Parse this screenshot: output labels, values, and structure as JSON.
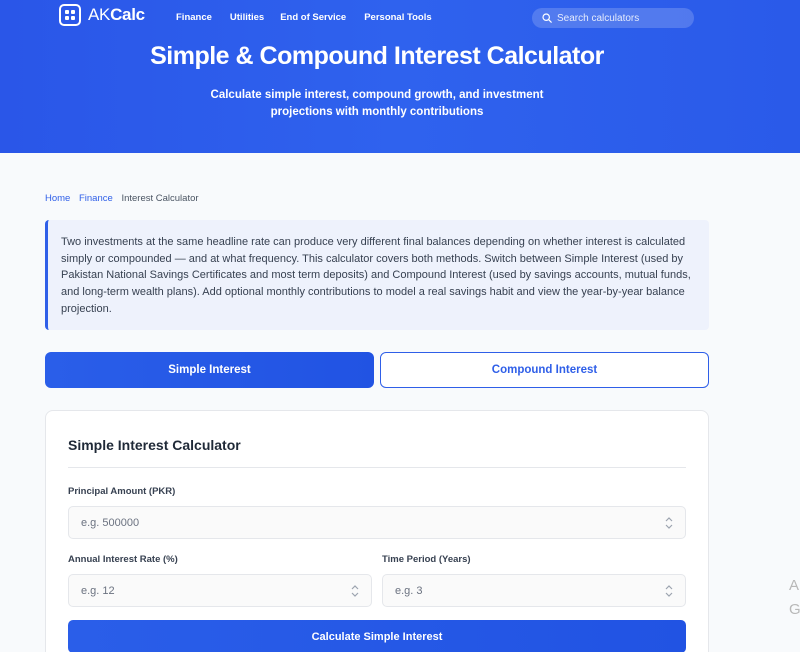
{
  "brand": {
    "prefix": "AK",
    "suffix": "Calc"
  },
  "nav": [
    "Finance",
    "Utilities",
    "End of Service",
    "Personal Tools"
  ],
  "search": {
    "placeholder": "Search calculators"
  },
  "hero": {
    "title": "Simple & Compound Interest Calculator",
    "subtitle_line1": "Calculate simple interest, compound growth, and investment",
    "subtitle_line2": "projections with monthly contributions"
  },
  "breadcrumb": [
    "Home",
    "Finance",
    "Interest Calculator"
  ],
  "intro": "Two investments at the same headline rate can produce very different final balances depending on whether interest is calculated simply or compounded — and at what frequency. This calculator covers both methods. Switch between Simple Interest (used by Pakistan National Savings Certificates and most term deposits) and Compound Interest (used by savings accounts, mutual funds, and long-term wealth plans). Add optional monthly contributions to model a real savings habit and view the year-by-year balance projection.",
  "tabs": {
    "simple": "Simple Interest",
    "compound": "Compound Interest",
    "active": "simple"
  },
  "form": {
    "title": "Simple Interest Calculator",
    "principal_label": "Principal Amount (PKR)",
    "principal_placeholder": "e.g. 500000",
    "rate_label": "Annual Interest Rate (%)",
    "rate_placeholder": "e.g. 12",
    "period_label": "Time Period (Years)",
    "period_placeholder": "e.g. 3",
    "submit": "Calculate Simple Interest"
  },
  "overflow_glyphs": [
    "A",
    "G"
  ],
  "colors": {
    "primary": "#2f5fe8",
    "hero_bg": "#2a56e8",
    "page_bg": "#f8fafc"
  },
  "icons": {
    "logo": "calculator-grid-icon",
    "search": "search-icon",
    "spinner": "spinner-arrows-icon"
  }
}
